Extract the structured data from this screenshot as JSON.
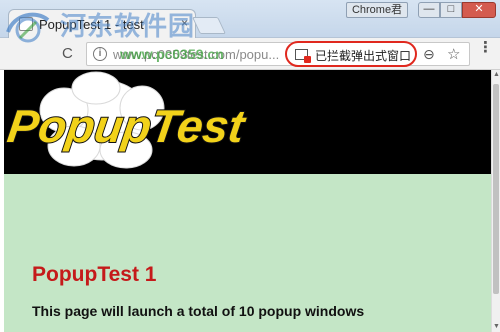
{
  "window": {
    "profile_label": "Chrome君",
    "min_glyph": "—",
    "max_glyph": "□",
    "close_glyph": "✕"
  },
  "tab": {
    "title": "PopupTest 1 - test",
    "close_glyph": "×"
  },
  "toolbar": {
    "reload_glyph": "C",
    "url": "www.pc0359test.com/popu...",
    "blocked_label": "已拦截弹出式窗口",
    "zoom_glyph": "⊖",
    "star_glyph": "☆",
    "menu_glyph": "⋮",
    "info_glyph": "i"
  },
  "watermark": {
    "site_name": "河东软件园",
    "site_url": "www.pc0359.cn"
  },
  "banner": {
    "logo_text": "PopupTest"
  },
  "page": {
    "heading": "PopupTest 1",
    "text": "This page will launch a total of 10 popup windows"
  },
  "scrollbar": {
    "up_glyph": "▲",
    "down_glyph": "▼"
  },
  "colors": {
    "blocked_outline": "#e0281e",
    "page_background": "#c4e6c6",
    "heading": "#c51a1a",
    "logo_fill": "#f2d21a"
  }
}
